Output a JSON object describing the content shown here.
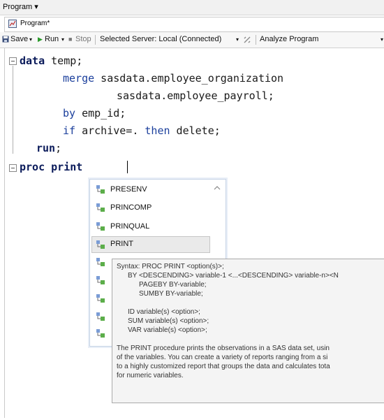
{
  "menu": {
    "program_label": "Program ▾"
  },
  "tab": {
    "title": "Program*",
    "icon": "program-file-icon"
  },
  "toolbar": {
    "save": "Save",
    "run": "Run",
    "stop": "Stop",
    "server": "Selected Server: Local (Connected)",
    "analyze": "Analyze Program"
  },
  "code": {
    "l1_kw": "data",
    "l1_rest": " temp;",
    "l2_kw": "merge",
    "l2_rest": " sasdata.employee_organization",
    "l3": "sasdata.employee_payroll;",
    "l4_kw": "by",
    "l4_rest": " emp_id;",
    "l5_kw": "if",
    "l5_mid": " archive=. ",
    "l5_kw2": "then",
    "l5_rest": " delete;",
    "l6": "run",
    "l6_rest": ";",
    "l7": "proc print"
  },
  "autocomplete": {
    "items": [
      "PRESENV",
      "PRINCOMP",
      "PRINQUAL",
      "PRINT"
    ],
    "selected": "PRINT",
    "item_icon": "procedure-icon"
  },
  "tooltip": {
    "syntax": "Syntax: PROC PRINT <option(s)>;",
    "by": "BY <DESCENDING> variable-1 <...<DESCENDING> variable-n><N",
    "pageby": "PAGEBY BY-variable;",
    "sumby": "SUMBY BY-variable;",
    "id": "ID variable(s) <option>;",
    "sum": "SUM variable(s) <option>;",
    "var": "VAR variable(s) <option>;",
    "desc1": "The PRINT procedure prints the observations in a SAS data set, usin",
    "desc2": "of the variables. You can create a variety of reports ranging from a si",
    "desc3": "to a highly customized report that groups the data and calculates tota",
    "desc4": "for numeric variables."
  }
}
